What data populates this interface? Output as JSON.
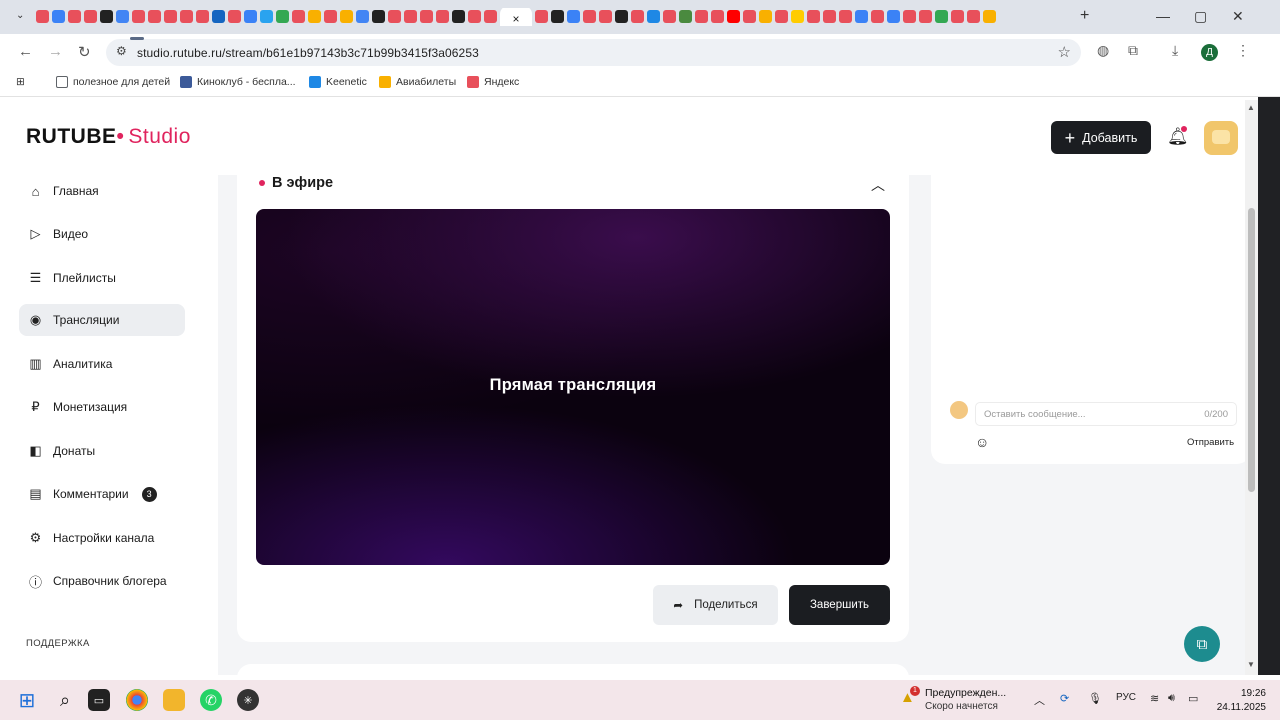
{
  "browser": {
    "url": "studio.rutube.ru/stream/b61e1b97143b3c71b99b3415f3a06253",
    "active_tab_close": "×",
    "tab_icon_colors": [
      "#e8505b",
      "#3b82f6",
      "#e8505b",
      "#e8505b",
      "#222222",
      "#4285f4",
      "#e8505b",
      "#e8505b",
      "#e8505b",
      "#e8505b",
      "#e8505b",
      "#1565c0",
      "#e8505b",
      "#3b82f6",
      "#2aa3ef",
      "#34a853",
      "#e8505b",
      "#f9b000",
      "#e8505b",
      "#f9b000",
      "#4285f4",
      "#222222",
      "#e8505b",
      "#e8505b",
      "#e8505b",
      "#e8505b",
      "#222222",
      "#e8505b",
      "#e8505b"
    ],
    "tab_icon_colors_right": [
      "#e8505b",
      "#222222",
      "#3b82f6",
      "#e8505b",
      "#e8505b",
      "#222222",
      "#e8505b",
      "#1e88e5",
      "#e8505b",
      "#4a8a3f",
      "#e8505b",
      "#e8505b",
      "#ff0000",
      "#e8505b",
      "#f9b000",
      "#e8505b",
      "#ffcc00",
      "#e8505b",
      "#e8505b",
      "#e8505b",
      "#3b82f6",
      "#e8505b",
      "#3b82f6",
      "#e8505b",
      "#e8505b",
      "#34a853",
      "#e8505b",
      "#e8505b",
      "#f9b000"
    ],
    "profile_letter": "Д"
  },
  "bookmarks": [
    {
      "label": "полезное для детей",
      "icon": "folder-icon",
      "color": "#5f6368"
    },
    {
      "label": "Киноклуб - беспла...",
      "icon": "film-icon",
      "color": "#3c5a99"
    },
    {
      "label": "Keenetic",
      "icon": "keenetic-icon",
      "color": "#1e88e5"
    },
    {
      "label": "Авиабилеты",
      "icon": "plane-icon",
      "color": "#f9b000"
    },
    {
      "label": "Яндекс",
      "icon": "yandex-icon",
      "color": "#e8505b"
    }
  ],
  "header": {
    "logo_main": "RUTUBE",
    "logo_dot": "•",
    "logo_studio": "Studio",
    "add_button": "Добавить"
  },
  "sidebar": {
    "items": [
      {
        "label": "Главная",
        "icon": "home-icon",
        "glyph": "⌂"
      },
      {
        "label": "Видео",
        "icon": "video-icon",
        "glyph": "▷"
      },
      {
        "label": "Плейлисты",
        "icon": "playlist-icon",
        "glyph": "☰"
      },
      {
        "label": "Трансляции",
        "icon": "broadcast-icon",
        "glyph": "◉",
        "active": true
      },
      {
        "label": "Аналитика",
        "icon": "analytics-icon",
        "glyph": "▥"
      },
      {
        "label": "Монетизация",
        "icon": "ruble-icon",
        "glyph": "₽"
      },
      {
        "label": "Донаты",
        "icon": "wallet-icon",
        "glyph": "◧"
      },
      {
        "label": "Комментарии",
        "icon": "comments-icon",
        "glyph": "▤",
        "badge": "3"
      },
      {
        "label": "Настройки канала",
        "icon": "settings-icon",
        "glyph": "⚙"
      },
      {
        "label": "Справочник блогера",
        "icon": "info-icon",
        "glyph": "ⓘ"
      }
    ],
    "support_label": "ПОДДЕРЖКА"
  },
  "stream": {
    "live_label": "В эфире",
    "player_text": "Прямая трансляция",
    "share_button": "Поделиться",
    "finish_button": "Завершить"
  },
  "chat": {
    "placeholder": "Оставить сообщение...",
    "counter": "0/200",
    "send_button": "Отправить"
  },
  "taskbar": {
    "warning_title": "Предупрежден...",
    "warning_subtitle": "Скоро начнется",
    "warning_badge": "1",
    "language": "РУС",
    "time": "19:26",
    "date": "24.11.2025"
  },
  "colors": {
    "accent": "#e0245e",
    "dark_button": "#1b1d21",
    "fab": "#1d8c8f"
  }
}
